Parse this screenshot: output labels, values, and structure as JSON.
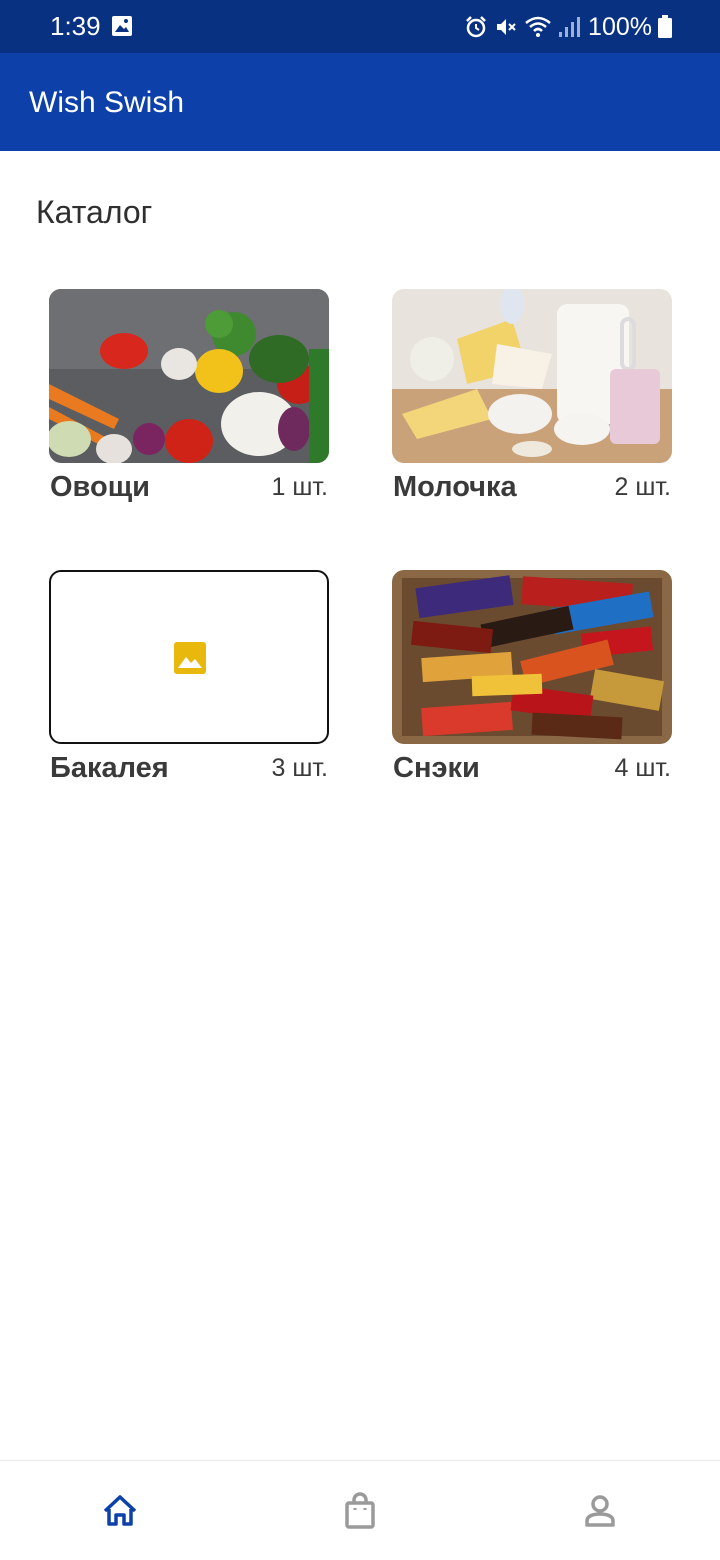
{
  "status_bar": {
    "time": "1:39",
    "battery": "100%",
    "icons": [
      "gallery-icon",
      "alarm-icon",
      "mute-icon",
      "wifi-icon",
      "signal-icon",
      "battery-icon"
    ]
  },
  "app_bar": {
    "title": "Wish Swish"
  },
  "catalog": {
    "title": "Каталог",
    "items": [
      {
        "name": "Овощи",
        "count": "1 шт.",
        "image": "vegetables-photo"
      },
      {
        "name": "Молочка",
        "count": "2 шт.",
        "image": "dairy-photo"
      },
      {
        "name": "Бакалея",
        "count": "3 шт.",
        "image": "image-placeholder-icon"
      },
      {
        "name": "Снэки",
        "count": "4 шт.",
        "image": "snacks-photo"
      }
    ]
  },
  "bottom_nav": {
    "items": [
      {
        "icon": "home-icon",
        "active": true
      },
      {
        "icon": "shopping-bag-icon",
        "active": false
      },
      {
        "icon": "profile-icon",
        "active": false
      }
    ]
  },
  "colors": {
    "status_bar": "#083182",
    "app_bar": "#0d40a8",
    "nav_active": "#0d40a8",
    "nav_inactive": "#9a9a9a",
    "placeholder_icon": "#e8b90c"
  }
}
